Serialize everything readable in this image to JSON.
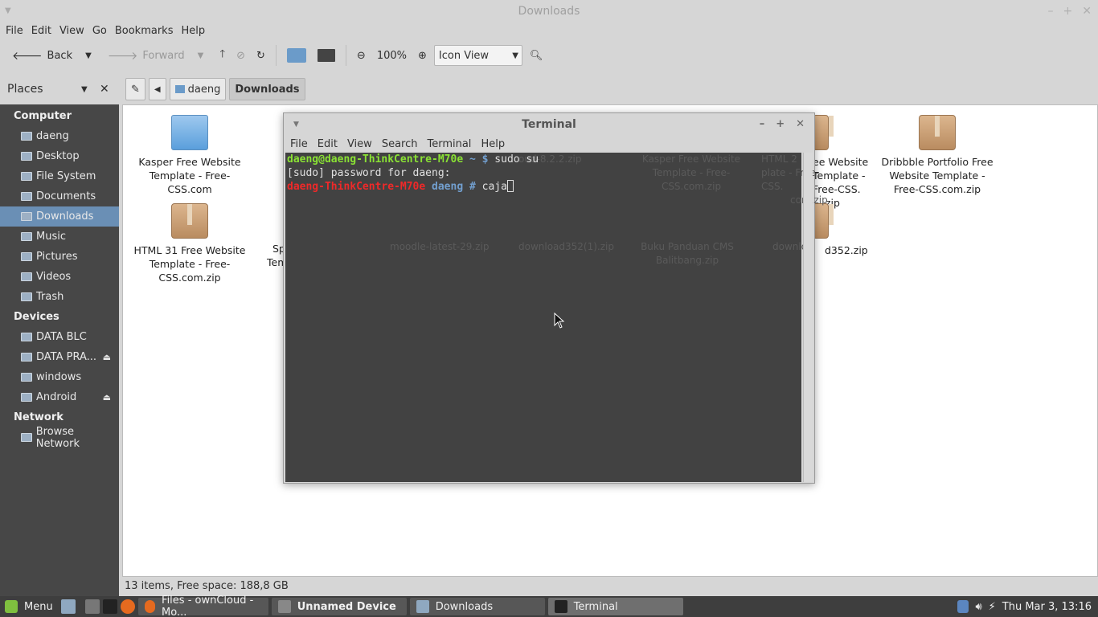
{
  "fm": {
    "title": "Downloads",
    "menu": [
      "File",
      "Edit",
      "View",
      "Go",
      "Bookmarks",
      "Help"
    ],
    "toolbar": {
      "back": "Back",
      "forward": "Forward",
      "zoom": "100%",
      "view_mode": "Icon View"
    },
    "places_label": "Places",
    "crumbs": [
      "daeng",
      "Downloads"
    ],
    "status": "13 items, Free space: 188,8 GB"
  },
  "sidebar": {
    "computer_heading": "Computer",
    "computer": [
      "daeng",
      "Desktop",
      "File System",
      "Documents",
      "Downloads",
      "Music",
      "Pictures",
      "Videos",
      "Trash"
    ],
    "devices_heading": "Devices",
    "devices": [
      "DATA BLC",
      "DATA PRA...",
      "windows",
      "Android"
    ],
    "network_heading": "Network",
    "network": [
      "Browse Network"
    ]
  },
  "files": [
    "Kasper Free Website Template - Free-CSS.com",
    "ee Website",
    "Template - Free-CSS.",
    ".zip",
    "Dribbble Portfolio Free Website Template - Free-CSS.com.zip",
    "HTML 31 Free Website Template - Free-CSS.com.zip",
    "Sp",
    "Tem",
    "d352.zip"
  ],
  "ghost_files": [
    "oud-8.2.2.zip",
    "Kasper Free Website Template - Free-CSS.com.zip",
    "HTML 2",
    "Free Website",
    "plate - Free-CSS.",
    "com.zip",
    "moodle-latest-29.zip",
    "download352(1).zip",
    "Buku Panduan CMS Balitbang.zip",
    "downlo"
  ],
  "terminal": {
    "title": "Terminal",
    "menu": [
      "File",
      "Edit",
      "View",
      "Search",
      "Terminal",
      "Help"
    ],
    "line1_prompt": "daeng@daeng-ThinkCentre-M70e",
    "line1_path": "~ $",
    "line1_cmd": " sudo su",
    "line2": "[sudo] password for daeng:",
    "line3_host": "daeng-ThinkCentre-M70e",
    "line3_dir": "daeng #",
    "line3_cmd": " caja"
  },
  "taskbar": {
    "menu": "Menu",
    "windows": [
      "Files - ownCloud - Mo...",
      "Unnamed Device",
      "Downloads",
      "Terminal"
    ],
    "clock": "Thu Mar  3, 13:16"
  }
}
